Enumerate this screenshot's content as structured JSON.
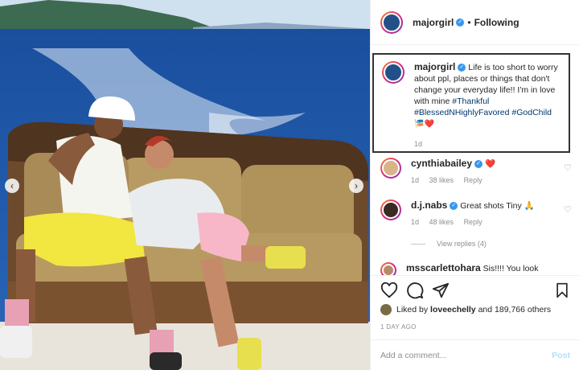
{
  "post": {
    "username": "majorgirl",
    "following_label": "Following",
    "separator": "•",
    "caption": {
      "text": "Life is too short to worry about ppl, places or things that don't change your everyday life!! I'm in love with mine",
      "tags": [
        "#Thankful",
        "#BlessedNHighlyFavored",
        "#GodChild"
      ],
      "emojis": "🎏❤️",
      "time": "1d"
    },
    "comments": [
      {
        "username": "cynthiabailey",
        "text": "",
        "emoji": "❤️",
        "time": "1d",
        "likes": "38 likes",
        "reply": "Reply"
      },
      {
        "username": "d.j.nabs",
        "text": "Great shots Tiny",
        "emoji": "🙏",
        "time": "1d",
        "likes": "48 likes",
        "reply": "Reply"
      },
      {
        "username": "msscarlettohara",
        "text": "Sis!!!! You look"
      }
    ],
    "view_replies": "View replies (4)",
    "liked_by_prefix": "Liked by",
    "liked_by_user": "loveechelly",
    "liked_by_suffix": "and 189,766 others",
    "time_ago": "1 DAY AGO",
    "add_comment_placeholder": "Add a comment...",
    "post_button": "Post"
  },
  "icons": {
    "verified": "verified-badge-icon",
    "heart": "heart-icon",
    "comment": "comment-icon",
    "share": "share-icon",
    "save": "bookmark-icon"
  },
  "colors": {
    "verified": "#3897f0",
    "hashtag": "#00376b",
    "muted": "#8e8e8e",
    "post_button": "#b2dffc"
  }
}
